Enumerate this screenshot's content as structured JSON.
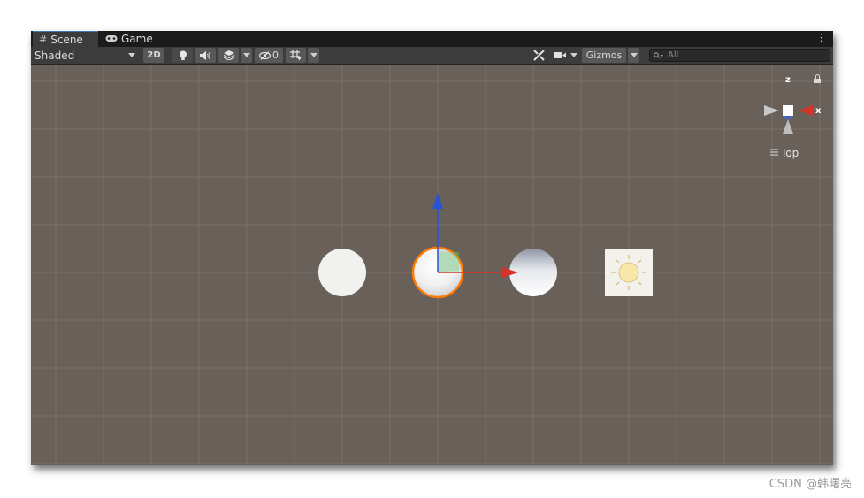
{
  "tabs": [
    {
      "label": "Scene",
      "icon": "grid-icon"
    },
    {
      "label": "Game",
      "icon": "gamepad-icon"
    }
  ],
  "toolbar": {
    "shading_mode": "Shaded",
    "mode_2d": "2D",
    "hidden_count": "0",
    "gizmos": "Gizmos",
    "search_placeholder": "All"
  },
  "orientation_gizmo": {
    "axis_z": "z",
    "axis_x": "x",
    "view_label": "Top"
  },
  "colors": {
    "viewport_bg": "#686059",
    "x_axis": "#d7322a",
    "z_axis": "#2a52d8",
    "selection_outline": "#ff7a00"
  },
  "watermark": "CSDN @韩曙亮"
}
